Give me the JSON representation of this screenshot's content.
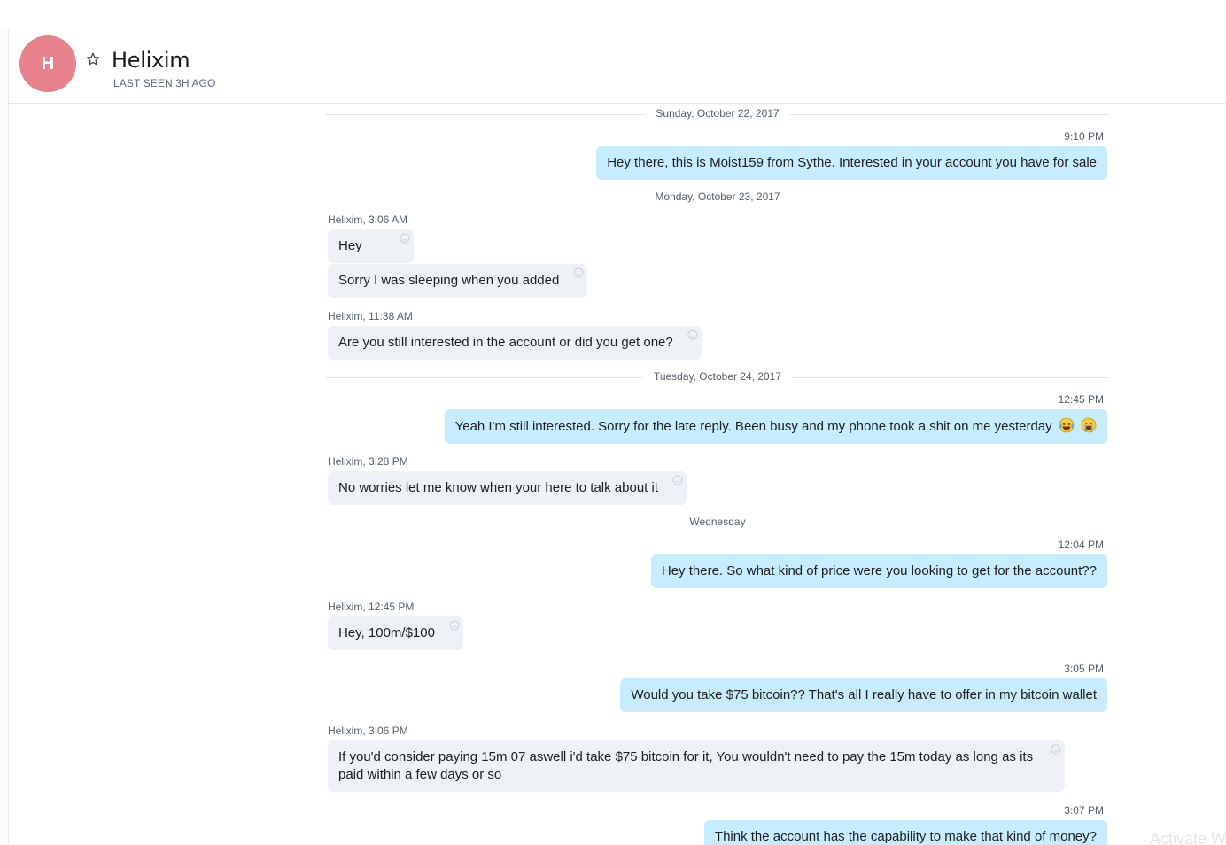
{
  "contact": {
    "initial": "H",
    "name": "Helixim",
    "last_seen": "LAST SEEN 3H AGO"
  },
  "dates": {
    "d1": "Sunday, October 22, 2017",
    "d2": "Monday, October 23, 2017",
    "d3": "Tuesday, October 24, 2017",
    "d4": "Wednesday"
  },
  "messages": {
    "m1": {
      "time": "9:10 PM",
      "text": "Hey there, this is Moist159 from Sythe. Interested in your account you have for sale"
    },
    "m2": {
      "sender": "Helixim, 3:06 AM",
      "text": "Hey"
    },
    "m3": {
      "text": "Sorry I was sleeping when you added"
    },
    "m4": {
      "sender": "Helixim, 11:38 AM",
      "text": "Are you still interested in the account or did you get one?"
    },
    "m5": {
      "time": "12:45 PM",
      "text": "Yeah I'm still interested. Sorry for the late reply. Been busy and my phone took a shit on me yesterday"
    },
    "m6": {
      "sender": "Helixim, 3:28 PM",
      "text": "No worries let me know when your here to talk about it"
    },
    "m7": {
      "time": "12:04 PM",
      "text": "Hey there. So what kind of price were you looking to get for the account??"
    },
    "m8": {
      "sender": "Helixim, 12:45 PM",
      "text": "Hey, 100m/$100"
    },
    "m9": {
      "time": "3:05 PM",
      "text": "Would you take $75 bitcoin?? That's all I really have to offer in my bitcoin wallet"
    },
    "m10": {
      "sender": "Helixim, 3:06 PM",
      "text": "If you'd consider paying 15m 07 aswell i'd take $75 bitcoin for it, You wouldn't need to pay the 15m today as long as its paid within a few days or so"
    },
    "m11": {
      "time": "3:07 PM",
      "text": "Think the account has the capability to make that kind of money?"
    }
  },
  "watermark": "Activate W",
  "colors": {
    "avatar": "#e8828c",
    "outgoing_bubble": "#c7ecfd",
    "incoming_bubble": "#eef2f6"
  },
  "icons": [
    "star-icon",
    "reaction-icon",
    "laughing-emoji-icon",
    "crying-emoji-icon"
  ]
}
